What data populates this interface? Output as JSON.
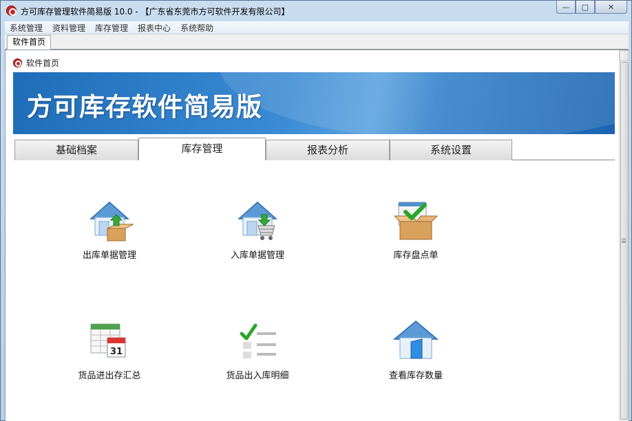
{
  "window": {
    "title": "方可库存管理软件简易版 10.0 - 【广东省东莞市方可软件开发有限公司】",
    "buttons": {
      "minimize": "—",
      "maximize": "□",
      "close": "✕"
    }
  },
  "menu": [
    "系统管理",
    "资料管理",
    "库存管理",
    "报表中心",
    "系统帮助"
  ],
  "doc_tab": "软件首页",
  "panel": {
    "header": "软件首页",
    "banner_title": "方可库存软件简易版"
  },
  "tabs": [
    {
      "label": "基础档案",
      "active": false
    },
    {
      "label": "库存管理",
      "active": true
    },
    {
      "label": "报表分析",
      "active": false
    },
    {
      "label": "系统设置",
      "active": false
    }
  ],
  "tiles": [
    {
      "label": "出库单据管理",
      "icon": "warehouse-out-icon"
    },
    {
      "label": "入库单据管理",
      "icon": "warehouse-in-icon"
    },
    {
      "label": "库存盘点单",
      "icon": "stocktake-box-icon"
    },
    {
      "label": "货品进出存汇总",
      "icon": "calendar-summary-icon"
    },
    {
      "label": "货品出入库明细",
      "icon": "checklist-detail-icon"
    },
    {
      "label": "查看库存数量",
      "icon": "warehouse-view-icon"
    }
  ],
  "colors": {
    "banner": "#2a7cc7",
    "accent_green": "#2aa52a",
    "app_red": "#c92525"
  }
}
